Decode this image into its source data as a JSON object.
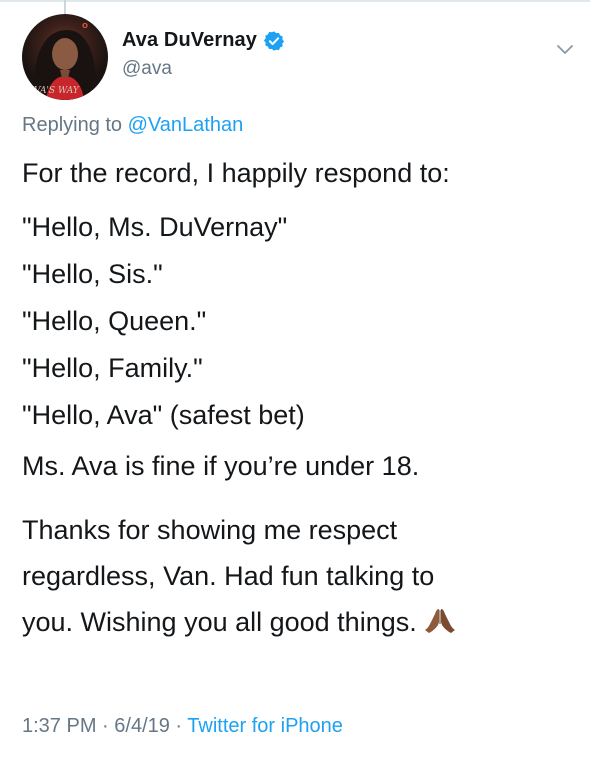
{
  "author": {
    "name": "Ava DuVernay",
    "handle": "@ava",
    "avatar_text": "AVA'S WAY"
  },
  "reply": {
    "prefix": "Replying to ",
    "mention": "@VanLathan"
  },
  "tweet": {
    "intro": "For the record, I happily respond to:",
    "greetings": [
      "\"Hello, Ms. DuVernay\"",
      "\"Hello, Sis.\"",
      "\"Hello, Queen.\"",
      "\"Hello, Family.\"",
      "\"Hello, Ava\" (safest bet)"
    ],
    "under18": "Ms. Ava is fine if you’re under 18.",
    "closing_lines": [
      "Thanks for showing me respect",
      "regardless, Van. Had fun talking to",
      "you. Wishing you all good things."
    ],
    "emoji": "folded-hands-medium-dark-skin"
  },
  "meta": {
    "time": "1:37 PM",
    "separator": " · ",
    "date": "6/4/19",
    "source": "Twitter for iPhone"
  },
  "colors": {
    "accent": "#1da1f2",
    "secondary_text": "#657786",
    "primary_text": "#14171a"
  }
}
